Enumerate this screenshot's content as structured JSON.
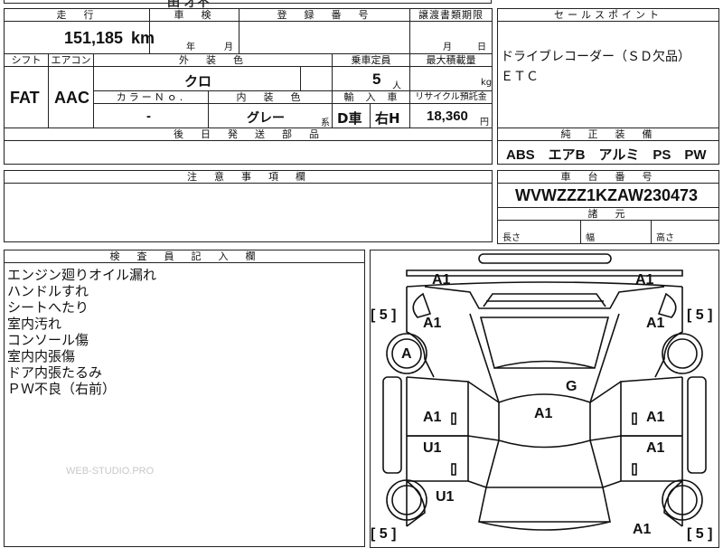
{
  "top_fragment": "田 才不",
  "header": {
    "mileage_label": "走　行",
    "inspection_label": "車　検",
    "reg_number_label": "登　録　番　号",
    "transfer_label": "譲渡書類期限",
    "sales_point_label": "セールスポイント"
  },
  "mileage": {
    "value": "151,185",
    "unit": "km"
  },
  "inspection": {
    "year_label": "年",
    "month_label": "月"
  },
  "transfer": {
    "month_label": "月",
    "day_label": "日"
  },
  "sales_points": [
    "ドライブレコーダー（ＳＤ欠品）",
    "ＥＴＣ"
  ],
  "row2_labels": {
    "shift": "シフト",
    "aircon": "エアコン",
    "exterior_color": "外　装　色",
    "capacity": "乗車定員",
    "max_load": "最大積載量"
  },
  "shift": "FAT",
  "aircon": "AAC",
  "exterior_color": "クロ",
  "capacity": {
    "value": "5",
    "unit": "人"
  },
  "max_load": {
    "value": "",
    "unit": "kg"
  },
  "row3_labels": {
    "color_no": "カラーＮｏ.",
    "interior_color": "内　装　色",
    "import": "輸　入　車",
    "recycle": "リサイクル預託金"
  },
  "color_no": "-",
  "interior_color": {
    "value": "グレー",
    "suffix": "系"
  },
  "import_type": "D車",
  "steering": "右H",
  "recycle": {
    "value": "18,360",
    "unit": "円"
  },
  "later_parts_label": "後　日　発　送　部　品",
  "genuine_equipment_label": "純　正　装　備",
  "genuine_equipment": "ABS　エアB　アルミ　PS　PW",
  "notes_label": "注　意　事　項　欄",
  "chassis_label": "車　台　番　号",
  "chassis_number": "WVWZZZ1KZAW230473",
  "dimensions_label": "諸　元",
  "dimensions": {
    "length": "長さ",
    "width": "幅",
    "height": "高さ"
  },
  "inspector_label": "検　査　員　記　入　欄",
  "inspector_notes": [
    "エンジン廻りオイル漏れ",
    "ハンドルすれ",
    "シートへたり",
    "室内汚れ",
    "コンソール傷",
    "室内内張傷",
    "ドア内張たるみ",
    "ＰＷ不良（右前）"
  ],
  "watermark": "WEB-STUDIO.PRO",
  "diagram_marks": {
    "front_left_top": "A1",
    "front_right_top": "A1",
    "fender_left": "A1",
    "fender_right": "A1",
    "wheel_front_left": "A",
    "windshield": "G",
    "roof": "A1",
    "door_front_left": "A1",
    "door_front_right": "A1",
    "door_rear_left": "U1",
    "door_rear_right": "A1",
    "wheel_rear_left": "U1",
    "rear_right": "A1"
  },
  "tire_marks": {
    "front_left": "[ 5 ]",
    "front_right": "[ 5 ]",
    "rear_left": "[ 5 ]",
    "rear_right": "[ 5 ]"
  }
}
